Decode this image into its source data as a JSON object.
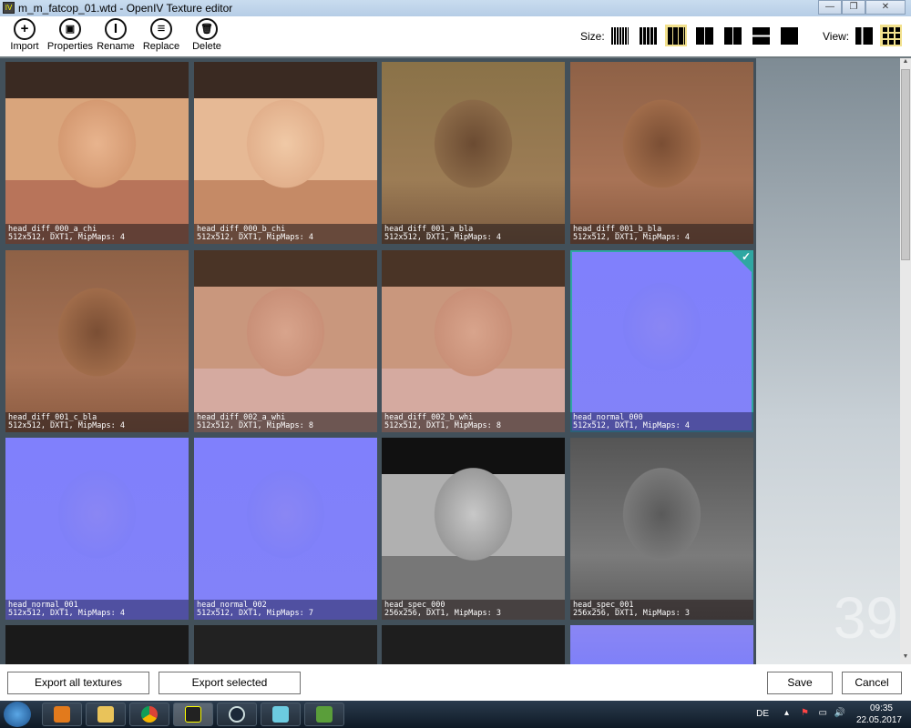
{
  "window": {
    "title": "m_m_fatcop_01.wtd - OpenIV Texture editor",
    "minimize": "—",
    "restore": "❐",
    "close": "✕"
  },
  "toolbar": {
    "items": [
      {
        "label": "Import",
        "icon": "plus-icon",
        "glyph": "+"
      },
      {
        "label": "Properties",
        "icon": "properties-icon",
        "glyph": "▣"
      },
      {
        "label": "Rename",
        "icon": "rename-icon",
        "glyph": "I"
      },
      {
        "label": "Replace",
        "icon": "replace-icon",
        "glyph": "≡"
      },
      {
        "label": "Delete",
        "icon": "trash-icon",
        "glyph": "🗑"
      }
    ],
    "size_label": "Size:",
    "view_label": "View:",
    "selected_size": 3,
    "selected_view": 2
  },
  "textures": [
    {
      "name": "head_diff_000_a_chi",
      "info": "512x512, DXT1, MipMaps: 4",
      "kind": "skin1"
    },
    {
      "name": "head_diff_000_b_chi",
      "info": "512x512, DXT1, MipMaps: 4",
      "kind": "skin2"
    },
    {
      "name": "head_diff_001_a_bla",
      "info": "512x512, DXT1, MipMaps: 4",
      "kind": "dark1"
    },
    {
      "name": "head_diff_001_b_bla",
      "info": "512x512, DXT1, MipMaps: 4",
      "kind": "dark2"
    },
    {
      "name": "head_diff_001_c_bla",
      "info": "512x512, DXT1, MipMaps: 4",
      "kind": "dark2"
    },
    {
      "name": "head_diff_002_a_whi",
      "info": "512x512, DXT1, MipMaps: 8",
      "kind": "whi"
    },
    {
      "name": "head_diff_002_b_whi",
      "info": "512x512, DXT1, MipMaps: 8",
      "kind": "whi"
    },
    {
      "name": "head_normal_000",
      "info": "512x512, DXT1, MipMaps: 4",
      "kind": "normal",
      "selected": true
    },
    {
      "name": "head_normal_001",
      "info": "512x512, DXT1, MipMaps: 4",
      "kind": "normal"
    },
    {
      "name": "head_normal_002",
      "info": "512x512, DXT1, MipMaps: 7",
      "kind": "normal"
    },
    {
      "name": "head_spec_000",
      "info": "256x256, DXT1, MipMaps: 3",
      "kind": "spec1"
    },
    {
      "name": "head_spec_001",
      "info": "256x256, DXT1, MipMaps: 3",
      "kind": "spec2"
    }
  ],
  "texture_count": "39",
  "bottom": {
    "export_all": "Export all textures",
    "export_selected": "Export selected",
    "save": "Save",
    "cancel": "Cancel"
  },
  "tray": {
    "lang": "DE",
    "time": "09:35",
    "date": "22.05.2017"
  }
}
